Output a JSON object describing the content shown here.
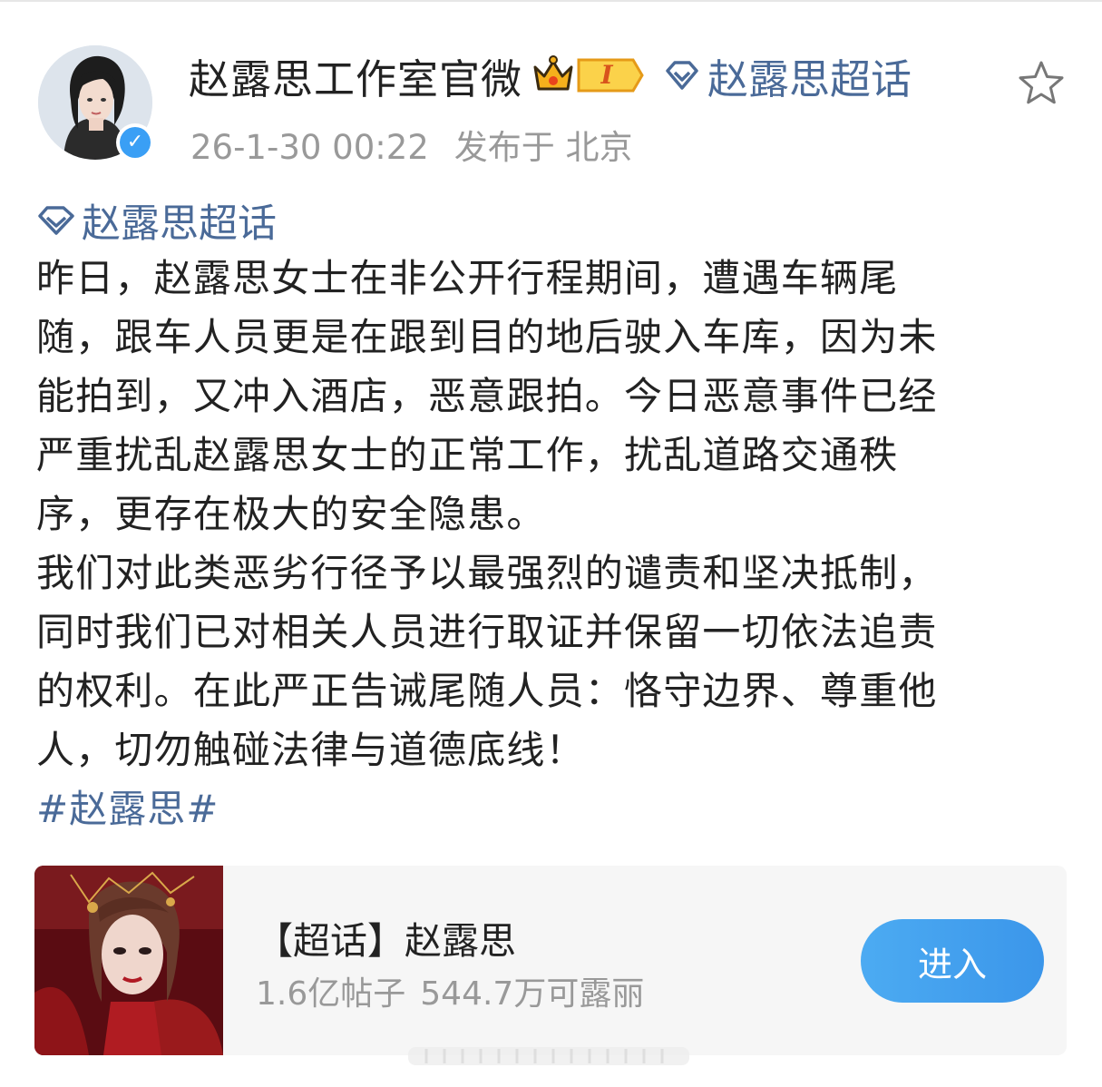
{
  "author": {
    "name": "赵露思工作室官微",
    "member_level": "I",
    "avatar_icon": "avatar-photo",
    "verified_icon": "verified-check-icon",
    "verified_glyph": "✓"
  },
  "post_meta": {
    "time": "26-1-30 00:22",
    "location": "发布于 北京"
  },
  "header_topic": {
    "icon": "diamond-icon",
    "label": "赵露思超话"
  },
  "post": {
    "topic_tag": "赵露思超话",
    "lines": [
      "昨日，赵露思女士在非公开行程期间，遭遇车辆尾",
      "随，跟车人员更是在跟到目的地后驶入车库，因为未",
      "能拍到，又冲入酒店，恶意跟拍。今日恶意事件已经",
      "严重扰乱赵露思女士的正常工作，扰乱道路交通秩",
      "序，更存在极大的安全隐患。",
      "我们对此类恶劣行径予以最强烈的谴责和坚决抵制，",
      "同时我们已对相关人员进行取证并保留一切依法追责",
      "的权利。在此严正告诫尾随人员：恪守边界、尊重他",
      "人，切勿触碰法律与道德底线！"
    ],
    "hashtag": "#赵露思#"
  },
  "supertopic_card": {
    "title": "【超话】赵露思",
    "posts": "1.6亿帖子",
    "fans": "544.7万可露丽",
    "enter_label": "进入"
  },
  "colors": {
    "link": "#4a6a98",
    "meta": "#999999",
    "button": "#3b96ea",
    "card_bg": "#f6f6f6"
  }
}
